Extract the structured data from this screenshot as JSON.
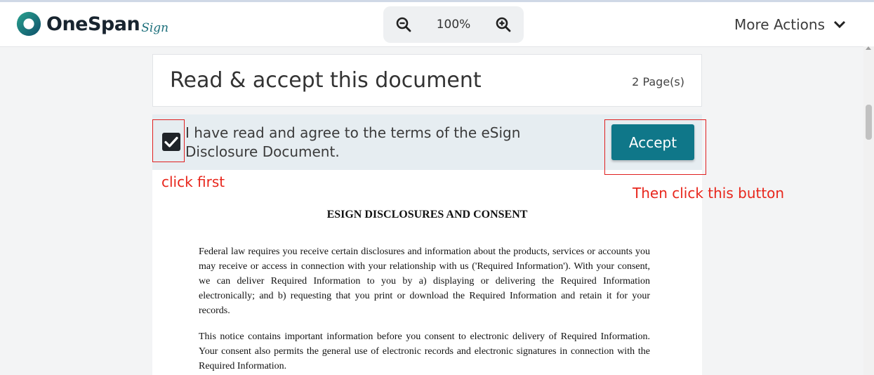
{
  "header": {
    "logo_text": "OneSpan",
    "logo_sub": "Sign",
    "zoom_level": "100%",
    "more_actions": "More Actions"
  },
  "card": {
    "title": "Read & accept this document",
    "pages": "2 Page(s)"
  },
  "consent": {
    "checked": true,
    "text": "I have read and agree to the terms of the eSign Disclosure Document.",
    "accept_label": "Accept"
  },
  "annotations": {
    "click_first": "click first",
    "then_click": "Then click this button"
  },
  "document": {
    "heading": "ESIGN DISCLOSURES AND CONSENT",
    "paragraphs": [
      "Federal law requires you receive certain disclosures and information about the products, services or accounts you may receive or access in connection with your relationship with us ('Required Information'). With your consent, we can deliver Required Information to you by a) displaying or delivering the Required Information electronically; and b) requesting that you print or download the Required Information and retain it for your records.",
      "This notice contains important information before you consent to electronic delivery of Required Information. Your consent also permits the general use of electronic records and electronic signatures in connection with the Required Information."
    ]
  },
  "colors": {
    "accent": "#0f7789",
    "annotation": "#e8261c",
    "logo_ring": "#1c6f7b"
  }
}
